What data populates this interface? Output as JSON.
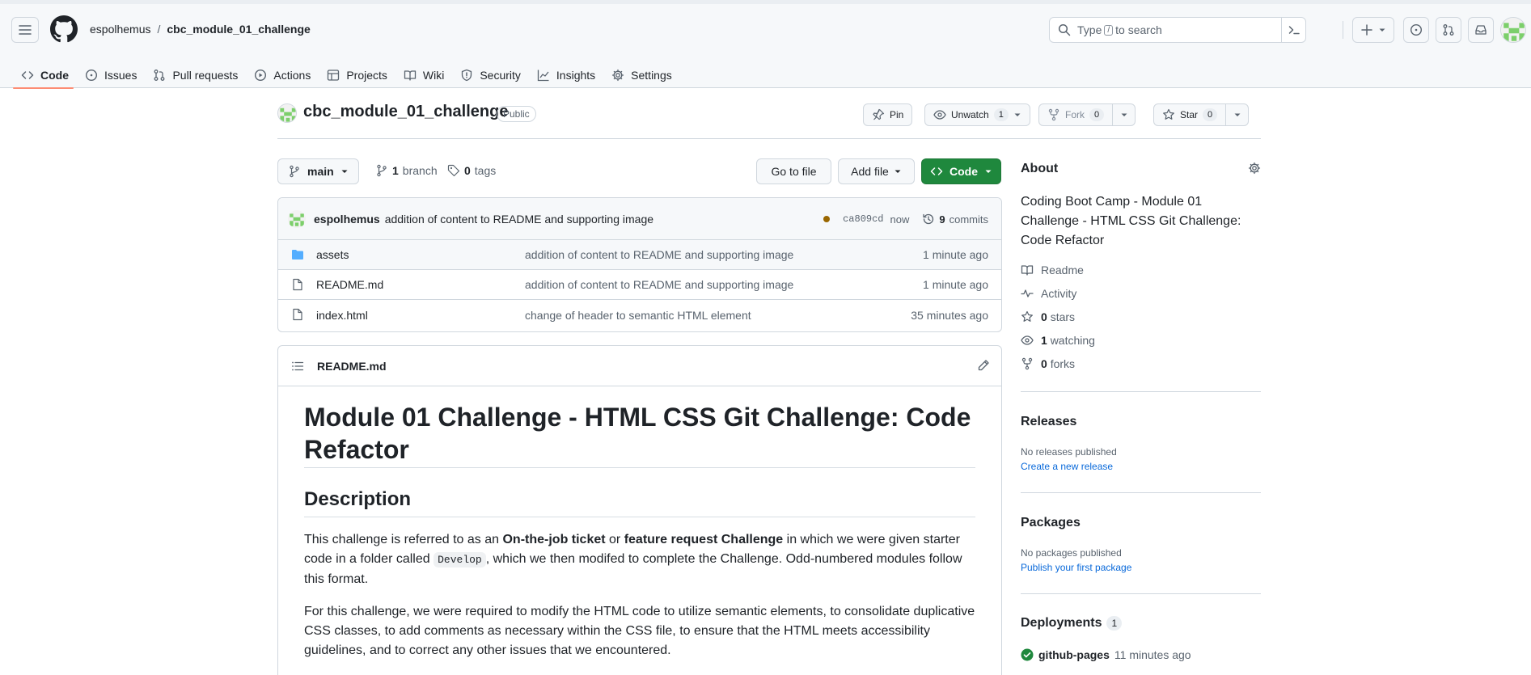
{
  "header": {
    "breadcrumb": {
      "owner": "espolhemus",
      "separator": "/",
      "repo": "cbc_module_01_challenge"
    },
    "search": {
      "prefix": "Type",
      "key": "/",
      "suffix": "to search"
    }
  },
  "tabs": [
    {
      "label": "Code",
      "icon": "code-icon",
      "active": true
    },
    {
      "label": "Issues",
      "icon": "issue-icon"
    },
    {
      "label": "Pull requests",
      "icon": "pull-request-icon"
    },
    {
      "label": "Actions",
      "icon": "play-icon"
    },
    {
      "label": "Projects",
      "icon": "table-icon"
    },
    {
      "label": "Wiki",
      "icon": "book-icon"
    },
    {
      "label": "Security",
      "icon": "shield-icon"
    },
    {
      "label": "Insights",
      "icon": "graph-icon"
    },
    {
      "label": "Settings",
      "icon": "gear-icon"
    }
  ],
  "repo": {
    "name": "cbc_module_01_challenge",
    "visibility": "Public",
    "pin_label": "Pin",
    "unwatch_label": "Unwatch",
    "watch_count": "1",
    "fork_label": "Fork",
    "fork_count": "0",
    "star_label": "Star",
    "star_count": "0"
  },
  "controls": {
    "branch": "main",
    "branch_count": "1",
    "branch_label": "branch",
    "tag_count": "0",
    "tag_label": "tags",
    "goto_file": "Go to file",
    "add_file": "Add file",
    "code": "Code"
  },
  "commit": {
    "author": "espolhemus",
    "message": "addition of content to README and supporting image",
    "sha": "ca809cd",
    "time": "now",
    "count": "9",
    "count_label": "commits",
    "status_color": "#9a6700"
  },
  "files": [
    {
      "name": "assets",
      "type": "folder",
      "message": "addition of content to README and supporting image",
      "age": "1 minute ago"
    },
    {
      "name": "README.md",
      "type": "file",
      "message": "addition of content to README and supporting image",
      "age": "1 minute ago"
    },
    {
      "name": "index.html",
      "type": "file",
      "message": "change of header to semantic HTML element",
      "age": "35 minutes ago"
    }
  ],
  "readme": {
    "filename": "README.md",
    "title": "Module 01 Challenge - HTML CSS Git Challenge: Code Refactor",
    "section": "Description",
    "p1": {
      "a": "This challenge is referred to as an ",
      "b1": "On-the-job ticket",
      "c": " or ",
      "b2": "feature request Challenge",
      "d": " in which we were given starter code in a folder called ",
      "code": "Develop",
      "e": ", which we then modifed to complete the Challenge. Odd-numbered modules follow this format."
    },
    "p2": "For this challenge, we were required to modify the HTML code to utilize semantic elements, to consolidate duplicative CSS classes, to add comments as necessary within the CSS file, to ensure that the HTML meets accessibility guidelines, and to correct any other issues that we encountered."
  },
  "about": {
    "heading": "About",
    "description": "Coding Boot Camp - Module 01 Challenge - HTML CSS Git Challenge: Code Refactor",
    "readme": "Readme",
    "activity": "Activity",
    "stars_count": "0",
    "stars_label": "stars",
    "watching_count": "1",
    "watching_label": "watching",
    "forks_count": "0",
    "forks_label": "forks"
  },
  "releases": {
    "heading": "Releases",
    "empty": "No releases published",
    "link": "Create a new release"
  },
  "packages": {
    "heading": "Packages",
    "empty": "No packages published",
    "link": "Publish your first package"
  },
  "deployments": {
    "heading": "Deployments",
    "count": "1",
    "env": "github-pages",
    "time": "11 minutes ago",
    "status_color": "#1f883d"
  },
  "colors": {
    "accent": "#0969da",
    "primary_button": "#1f883d",
    "tab_underline": "#fd8c73",
    "folder": "#54aeff"
  }
}
